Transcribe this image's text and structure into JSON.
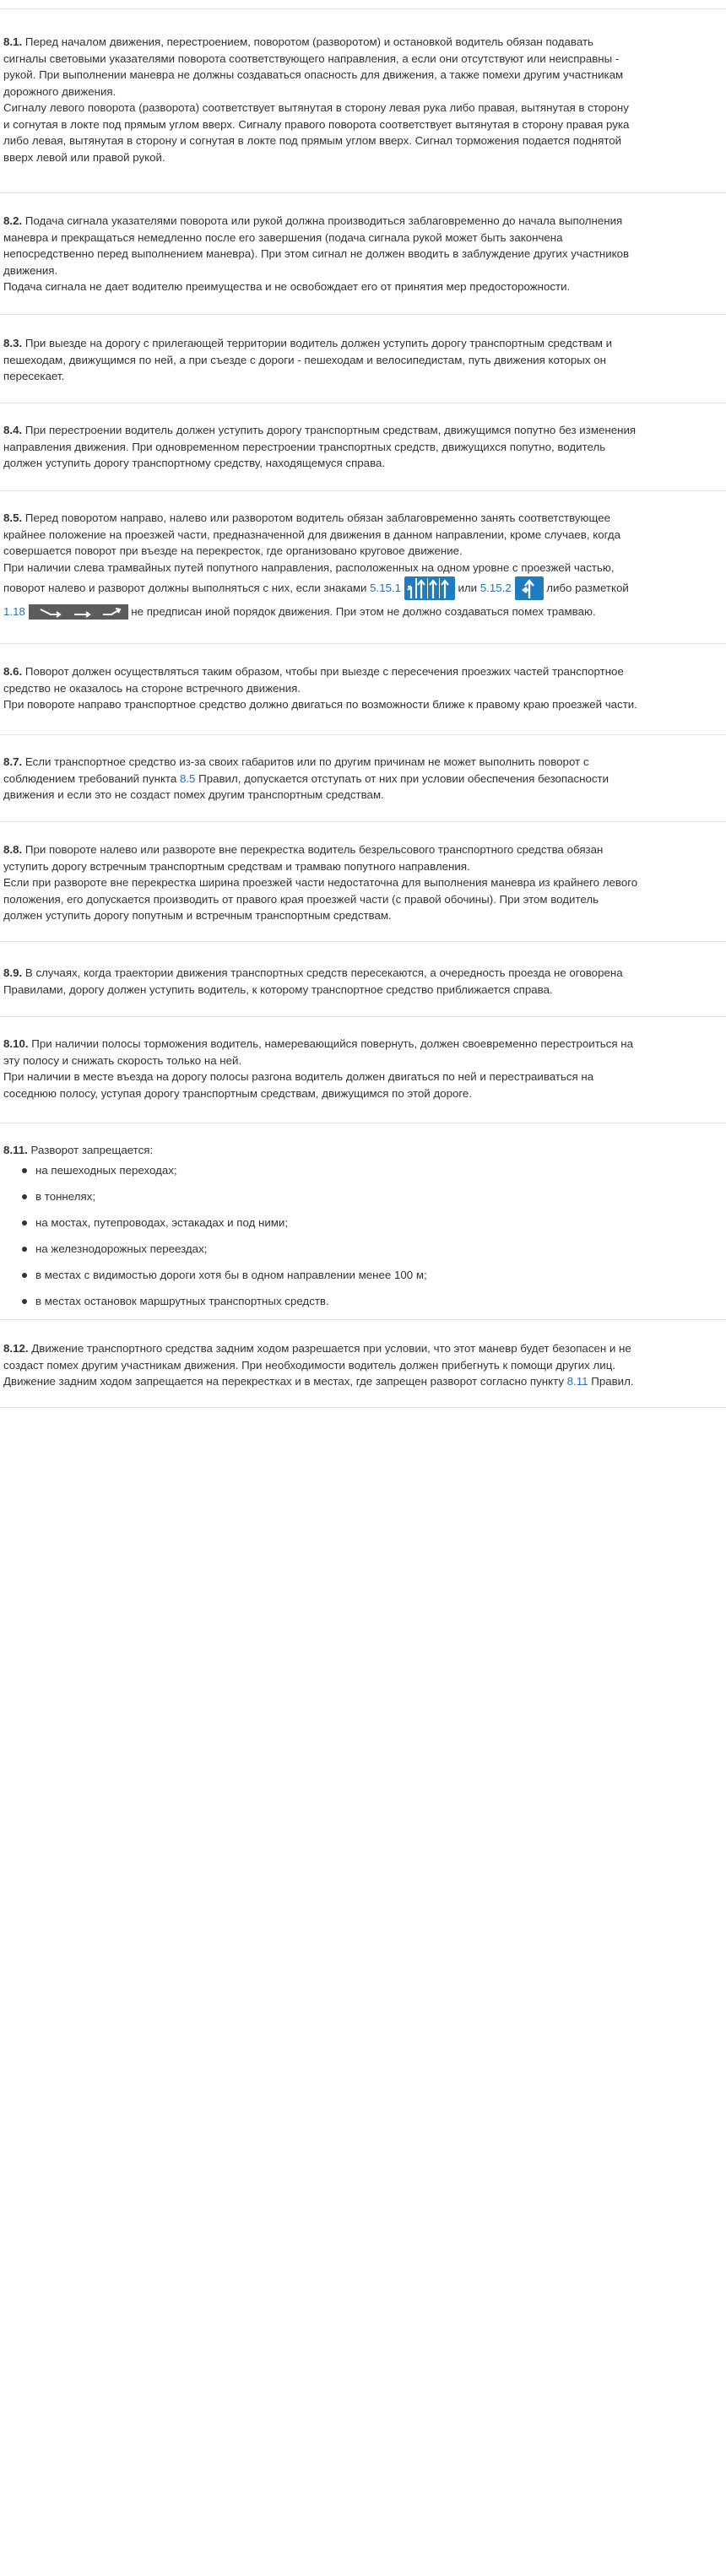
{
  "sections": [
    {
      "num": "8.1.",
      "paragraphs": [
        [
          "Перед началом движения, перестроением, поворотом (разворотом) и остановкой водитель обязан подавать",
          "сигналы световыми указателями поворота соответствующего направления, а если они отсутствуют или неисправны -",
          "рукой. При выполнении маневра не должны создаваться опасность для движения, а также помехи другим участникам",
          "дорожного движения.",
          "Сигналу левого поворота (разворота) соответствует вытянутая в сторону левая рука либо правая, вытянутая в сторону",
          "и согнутая в локте под прямым углом вверх. Сигналу правого поворота соответствует вытянутая в сторону правая рука",
          "либо левая, вытянутая в сторону и согнутая в локте под прямым углом вверх. Сигнал торможения подается поднятой",
          "вверх левой или правой рукой."
        ]
      ]
    },
    {
      "num": "8.2.",
      "lines": [
        "Подача сигнала указателями поворота или рукой должна производиться заблаговременно до начала выполнения",
        "маневра и прекращаться немедленно после его завершения (подача сигнала рукой может быть закончена",
        "непосредственно перед выполнением маневра). При этом сигнал не должен вводить в заблуждение других участников",
        "движения.",
        "Подача сигнала не дает водителю преимущества и не освобождает его от принятия мер предосторожности."
      ]
    },
    {
      "num": "8.3.",
      "lines": [
        "При выезде на дорогу с прилегающей территории водитель должен уступить дорогу транспортным средствам и",
        "пешеходам, движущимся по ней, а при съезде с дороги - пешеходам и велосипедистам, путь движения которых он",
        "пересекает."
      ]
    },
    {
      "num": "8.4.",
      "lines": [
        "При перестроении водитель должен уступить дорогу транспортным средствам, движущимся попутно без изменения",
        "направления движения. При одновременном перестроении транспортных средств, движущихся попутно, водитель",
        "должен уступить дорогу транспортному средству, находящемуся справа."
      ]
    },
    {
      "num": "8.5.",
      "lines": [
        "Перед поворотом направо, налево или разворотом водитель обязан заблаговременно занять соответствующее",
        "крайнее положение на проезжей части, предназначенной для движения в данном направлении, кроме случаев, когда",
        "совершается поворот при въезде на перекресток, где организовано круговое движение.",
        "При наличии слева трамвайных путей попутного направления, расположенных на одном уровне с проезжей частью,"
      ],
      "line5_a": "поворот налево и разворот должны выполняться с них, если знаками ",
      "link_5151": "5.15.1",
      "line5_or": " или ",
      "link_5152": "5.15.2",
      "line5_b": " либо разметкой",
      "link_118": "1.18",
      "line6_b": " не предписан иной порядок движения. При этом не должно создаваться помех трамваю."
    },
    {
      "num": "8.6.",
      "lines": [
        "Поворот должен осуществляться таким образом, чтобы при выезде с пересечения проезжих частей транспортное",
        "средство не оказалось на стороне встречного движения.",
        "При повороте направо транспортное средство должно двигаться по возможности ближе к правому краю проезжей части."
      ]
    },
    {
      "num": "8.7.",
      "line1": "Если транспортное средство из-за своих габаритов или по другим причинам не может выполнить поворот с",
      "line2_a": "соблюдением требований пункта ",
      "link": "8.5",
      "line2_b": " Правил, допускается отступать от них при условии обеспечения безопасности",
      "line3": "движения и если это не создаст помех другим транспортным средствам."
    },
    {
      "num": "8.8.",
      "lines": [
        "При повороте налево или развороте вне перекрестка водитель безрельсового транспортного средства обязан",
        "уступить дорогу встречным транспортным средствам и трамваю попутного направления.",
        "Если при развороте вне перекрестка ширина проезжей части недостаточна для выполнения маневра из крайнего левого",
        "положения, его допускается производить от правого края проезжей части (с правой обочины). При этом водитель",
        "должен уступить дорогу попутным и встречным транспортным средствам."
      ]
    },
    {
      "num": "8.9.",
      "lines": [
        "В случаях, когда траектории движения транспортных средств пересекаются, а очередность проезда не оговорена",
        "Правилами, дорогу должен уступить водитель, к которому транспортное средство приближается справа."
      ]
    },
    {
      "num": "8.10.",
      "lines": [
        "При наличии полосы торможения водитель, намеревающийся повернуть, должен своевременно перестроиться на",
        "эту полосу и снижать скорость только на ней.",
        "При наличии в месте въезда на дорогу полосы разгона водитель должен двигаться по ней и перестраиваться на",
        "соседнюю полосу, уступая дорогу транспортным средствам, движущимся по этой дороге."
      ]
    },
    {
      "num": "8.11.",
      "intro": "Разворот запрещается:",
      "items": [
        "на пешеходных переходах;",
        "в тоннелях;",
        "на мостах, путепроводах, эстакадах и под ними;",
        "на железнодорожных переездах;",
        "в местах с видимостью дороги хотя бы в одном направлении менее 100 м;",
        "в местах остановок маршрутных транспортных средств."
      ]
    },
    {
      "num": "8.12.",
      "line1": "Движение транспортного средства задним ходом разрешается при условии, что этот маневр будет безопасен и не",
      "line2": "создаст помех другим участникам движения. При необходимости водитель должен прибегнуть к помощи других лиц.",
      "line3_a": "Движение задним ходом запрещается на перекрестках и в местах, где запрещен разворот согласно пункту ",
      "link": "8.11",
      "line3_b": " Правил."
    }
  ],
  "colors": {
    "text": "#333333",
    "link": "#2a6ebb",
    "rule": "#e6e6e6",
    "sign_blue": "#1f7bc2",
    "marking_gray": "#5c5c5c"
  },
  "icons": {
    "sign_5151": "lane-direction-sign-icon",
    "sign_5152": "lane-direction-sign-icon",
    "marking_118": "lane-arrows-marking-icon"
  }
}
